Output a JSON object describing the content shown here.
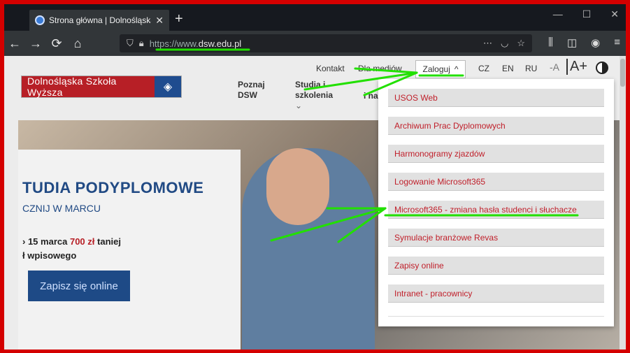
{
  "browser": {
    "tab_title": "Strona główna | Dolnośląska Szkoła Wyższa",
    "tab_close": "✕",
    "new_tab": "+",
    "url_prefix": "https://www.",
    "url_domain": "dsw.edu.pl",
    "url_menu": "⋯",
    "window_controls": [
      "—",
      "☐",
      "✕"
    ]
  },
  "site": {
    "logo_text": "Dolnośląska Szkoła Wyższa",
    "topbar": {
      "contact": "Kontakt",
      "media": "Dla mediów",
      "login": "Zaloguj",
      "lang_cz": "CZ",
      "lang_en": "EN",
      "lang_ru": "RU",
      "font_smaller": "-A",
      "font_larger": "A+"
    },
    "main_nav": {
      "poznaj": "Poznaj DSW",
      "studia": "Studia i szkolenia",
      "nauka": "i na"
    },
    "hero": {
      "title": "TUDIA PODYPLOMOWE",
      "subtitle": "CZNIJ W MARCU",
      "promo_line1_a": "15 marca",
      "promo_price": "700 zł",
      "promo_line1_b": "taniej",
      "promo_line2": "ł wpisowego",
      "cta": "Zapisz się online"
    },
    "login_menu": [
      "USOS Web",
      "Archiwum Prac Dyplomowych",
      "Harmonogramy zjazdów",
      "Logowanie Microsoft365",
      "Microsoft365 - zmiana hasła studenci i słuchacze",
      "Symulacje branżowe Revas",
      "Zapisy online",
      "Intranet - pracownicy"
    ]
  },
  "colors": {
    "brand_red": "#b71f26",
    "brand_blue": "#1e4a86",
    "annotation_green": "#22e000",
    "frame_red": "#d40000"
  }
}
